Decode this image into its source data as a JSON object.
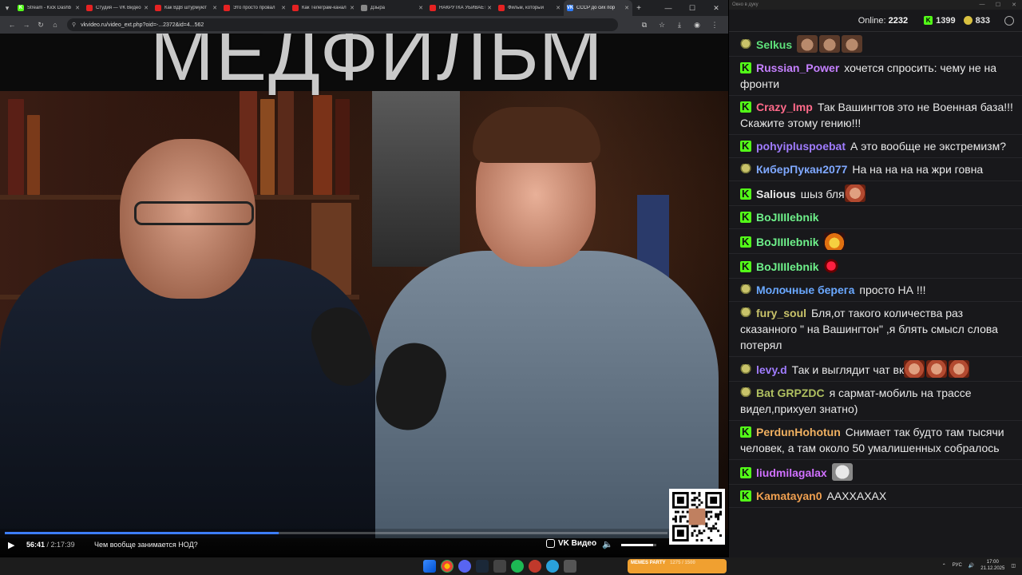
{
  "browser": {
    "tabs": [
      {
        "title": "Stream - Kick Dashb",
        "color": "#53fc18",
        "glyph": "K"
      },
      {
        "title": "Студия — VK Видео",
        "color": "#e52222",
        "glyph": ""
      },
      {
        "title": "Как ВДВ штурмуют",
        "color": "#e52222",
        "glyph": ""
      },
      {
        "title": "Это просто провал",
        "color": "#e52222",
        "glyph": ""
      },
      {
        "title": "Как Телеграм-канал",
        "color": "#e52222",
        "glyph": ""
      },
      {
        "title": "Дзыра",
        "color": "#888888",
        "glyph": ""
      },
      {
        "title": "НАКРУТКА УБИВАЕТ",
        "color": "#e52222",
        "glyph": ""
      },
      {
        "title": "Фильм, который",
        "color": "#e52222",
        "glyph": ""
      },
      {
        "title": "СССР до сих пор",
        "color": "#2b7bff",
        "glyph": "VK"
      }
    ],
    "url": "vkvideo.ru/video_ext.php?oid=-...2372&id=4...562",
    "video": {
      "overlay_title": "МЕДФИЛЬМ",
      "current_time": "56:41",
      "duration": "/ 2:17:39",
      "chapter": "Чем вообще занимается НОД?",
      "progress": 0.413,
      "volume": 0.9,
      "brand": "VK Видео"
    }
  },
  "chat": {
    "window_title": "Окно в дуку",
    "online_label": "Online:",
    "online_count": "2232",
    "stat_green": "1399",
    "stat_gold": "833",
    "messages": [
      {
        "badge": "pepe",
        "user": "Selkus",
        "color": "#5ee07a",
        "text": "",
        "emotes": [
          "cat",
          "cat",
          "cat"
        ]
      },
      {
        "badge": "kick",
        "user": "Russian_Power",
        "color": "#c580ff",
        "text": "хочется спросить: чему не на фронти",
        "emotes": []
      },
      {
        "badge": "kick",
        "user": "Crazy_Imp",
        "color": "#ff6a8a",
        "text": "Так Вашингтов это не Военная база!!! Скажите этому гению!!!",
        "emotes": []
      },
      {
        "badge": "kick",
        "user": "pohyiplusроebat",
        "color": "#a07cff",
        "text": "А это вообще не экстремизм?",
        "emotes": []
      },
      {
        "badge": "pepe",
        "user": "КиберПукан2077",
        "color": "#7fa8ff",
        "text": "На на на на на жри говна",
        "emotes": []
      },
      {
        "badge": "kick",
        "user": "Salious",
        "color": "#e8e8e8",
        "text": "шыз бля",
        "emotes": [
          "face"
        ]
      },
      {
        "badge": "kick",
        "user": "BoJIIIlebnik",
        "color": "#6ef08a",
        "text": "",
        "emotes": []
      },
      {
        "badge": "kick",
        "user": "BoJIIIlebnik",
        "color": "#6ef08a",
        "text": "",
        "emotes": [
          "fire"
        ]
      },
      {
        "badge": "kick",
        "user": "BoJIIIlebnik",
        "color": "#6ef08a",
        "text": "",
        "emotes": [
          "red"
        ]
      },
      {
        "badge": "pepe",
        "user": "Молочные берега",
        "color": "#6aa8ff",
        "text": "просто НА !!!",
        "emotes": []
      },
      {
        "badge": "pepe",
        "user": "fury_soul",
        "color": "#c9c36a",
        "text": "Бля,от такого количества раз сказанного \" на Вашингтон\" ,я блять смысл слова потерял",
        "emotes": []
      },
      {
        "badge": "pepe",
        "user": "levy.d",
        "color": "#a07cff",
        "text": "Так и выглядит чат вк",
        "emotes": [
          "face",
          "face",
          "face"
        ]
      },
      {
        "badge": "pepe",
        "user": "Bat GRPZDC",
        "color": "#b0c060",
        "text": "я сармат-мобиль на трассе видел,прихуел знатно)",
        "emotes": []
      },
      {
        "badge": "kick",
        "user": "PerdunHohotun",
        "color": "#f0b060",
        "text": "Снимает так будто там тысячи человек, а там около 50 умалишенных собралось",
        "emotes": []
      },
      {
        "badge": "kick",
        "user": "liudmilagalax",
        "color": "#d070ff",
        "text": "",
        "emotes": [
          "grey"
        ]
      },
      {
        "badge": "kick",
        "user": "Kamatayan0",
        "color": "#f0a050",
        "text": "АAXXAXAX",
        "emotes": []
      }
    ]
  },
  "taskbar": {
    "memes_label": "MEMES PARTY",
    "memes_sub": "1275 / 1500",
    "lang": "РУС",
    "time": "17:00",
    "date": "21.12.2025"
  }
}
